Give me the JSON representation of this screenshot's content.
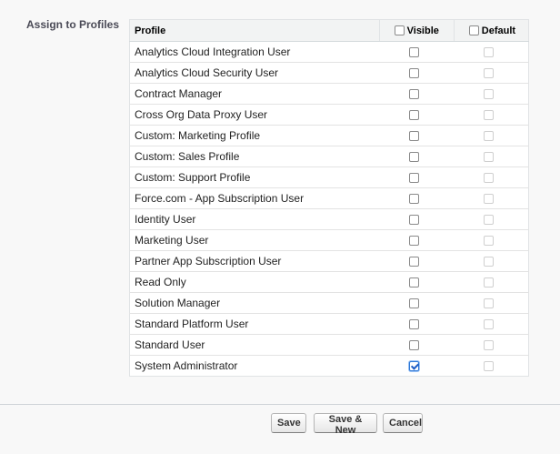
{
  "section": {
    "label": "Assign to Profiles"
  },
  "table": {
    "headers": {
      "profile": "Profile",
      "visible": "Visible",
      "default": "Default"
    },
    "rows": [
      {
        "name": "Analytics Cloud Integration User",
        "visible": false
      },
      {
        "name": "Analytics Cloud Security User",
        "visible": false
      },
      {
        "name": "Contract Manager",
        "visible": false
      },
      {
        "name": "Cross Org Data Proxy User",
        "visible": false
      },
      {
        "name": "Custom: Marketing Profile",
        "visible": false
      },
      {
        "name": "Custom: Sales Profile",
        "visible": false
      },
      {
        "name": "Custom: Support Profile",
        "visible": false
      },
      {
        "name": "Force.com - App Subscription User",
        "visible": false
      },
      {
        "name": "Identity User",
        "visible": false
      },
      {
        "name": "Marketing User",
        "visible": false
      },
      {
        "name": "Partner App Subscription User",
        "visible": false
      },
      {
        "name": "Read Only",
        "visible": false
      },
      {
        "name": "Solution Manager",
        "visible": false
      },
      {
        "name": "Standard Platform User",
        "visible": false
      },
      {
        "name": "Standard User",
        "visible": false
      },
      {
        "name": "System Administrator",
        "visible": true
      }
    ]
  },
  "buttons": {
    "save": "Save",
    "save_new": "Save & New",
    "cancel": "Cancel"
  },
  "colors": {
    "checkbox_checked": "#2f78d7"
  }
}
